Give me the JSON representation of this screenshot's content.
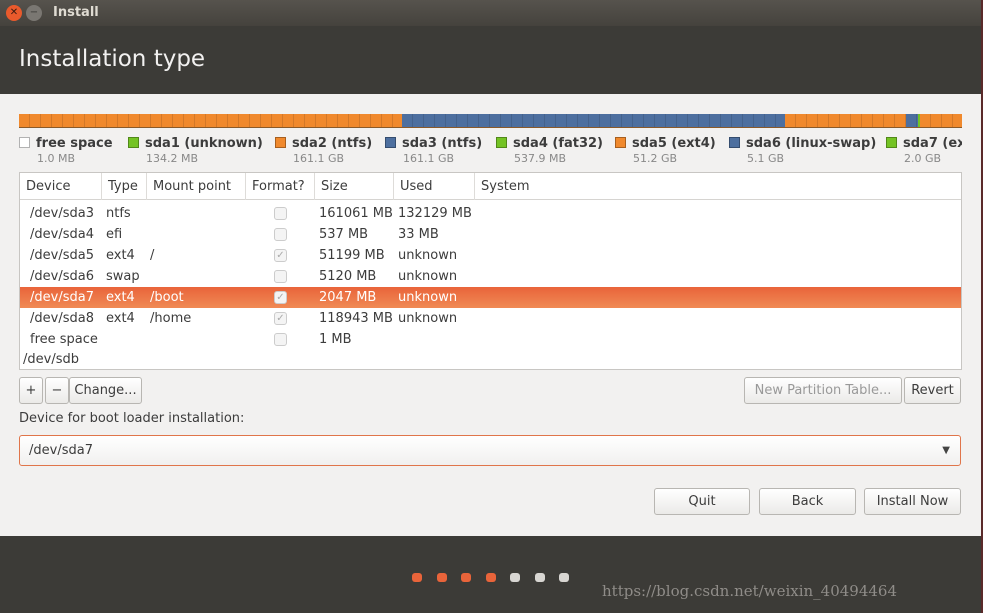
{
  "window": {
    "title": "Install",
    "close_icon": "close-icon",
    "minimize_icon": "minimize-icon"
  },
  "header": {
    "title": "Installation type"
  },
  "partition_bar": {
    "segments": [
      {
        "color": "#f0892d",
        "fraction": 0.406
      },
      {
        "color": "#4d6f9f",
        "fraction": 0.406
      },
      {
        "color": "#f0892d",
        "fraction": 0.129
      },
      {
        "color": "#4d6f9f",
        "fraction": 0.012
      },
      {
        "color": "#74c324",
        "fraction": 0.003
      },
      {
        "color": "#f0892d",
        "fraction": 0.044
      }
    ]
  },
  "legend": [
    {
      "name": "free space",
      "size": "1.0 MB",
      "color": "#ffffff"
    },
    {
      "name": "sda1 (unknown)",
      "size": "134.2 MB",
      "color": "#74c324"
    },
    {
      "name": "sda2 (ntfs)",
      "size": "161.1 GB",
      "color": "#f0892d"
    },
    {
      "name": "sda3 (ntfs)",
      "size": "161.1 GB",
      "color": "#4d6f9f"
    },
    {
      "name": "sda4 (fat32)",
      "size": "537.9 MB",
      "color": "#74c324"
    },
    {
      "name": "sda5 (ext4)",
      "size": "51.2 GB",
      "color": "#f0892d"
    },
    {
      "name": "sda6 (linux-swap)",
      "size": "5.1 GB",
      "color": "#4d6f9f"
    },
    {
      "name": "sda7 (ex",
      "size": "2.0 GB",
      "color": "#74c324"
    }
  ],
  "table": {
    "columns": [
      "Device",
      "Type",
      "Mount point",
      "Format?",
      "Size",
      "Used",
      "System"
    ],
    "rows": [
      {
        "device": "/dev/sda3",
        "type": "ntfs",
        "mount": "",
        "format": false,
        "size": "161061 MB",
        "used": "132129 MB"
      },
      {
        "device": "/dev/sda4",
        "type": "efi",
        "mount": "",
        "format": false,
        "size": "537 MB",
        "used": "33 MB"
      },
      {
        "device": "/dev/sda5",
        "type": "ext4",
        "mount": "/",
        "format": true,
        "size": "51199 MB",
        "used": "unknown"
      },
      {
        "device": "/dev/sda6",
        "type": "swap",
        "mount": "",
        "format": false,
        "size": "5120 MB",
        "used": "unknown"
      },
      {
        "device": "/dev/sda7",
        "type": "ext4",
        "mount": "/boot",
        "format": true,
        "size": "2047 MB",
        "used": "unknown",
        "selected": true
      },
      {
        "device": "/dev/sda8",
        "type": "ext4",
        "mount": "/home",
        "format": true,
        "size": "118943 MB",
        "used": "unknown"
      },
      {
        "device": "free space",
        "type": "",
        "mount": "",
        "format": false,
        "size": "1 MB",
        "used": ""
      }
    ],
    "disk": "/dev/sdb"
  },
  "toolbar": {
    "add": "+",
    "remove": "−",
    "change": "Change...",
    "new_table": "New Partition Table...",
    "revert": "Revert"
  },
  "bootloader": {
    "label": "Device for boot loader installation:",
    "value": "/dev/sda7"
  },
  "buttons": {
    "quit": "Quit",
    "back": "Back",
    "install": "Install Now"
  },
  "progress": {
    "total_steps": 7,
    "completed_steps": 4,
    "active_color": "#e9643a",
    "inactive_color": "#d8d6d2"
  },
  "watermark": "https://blog.csdn.net/weixin_40494464"
}
